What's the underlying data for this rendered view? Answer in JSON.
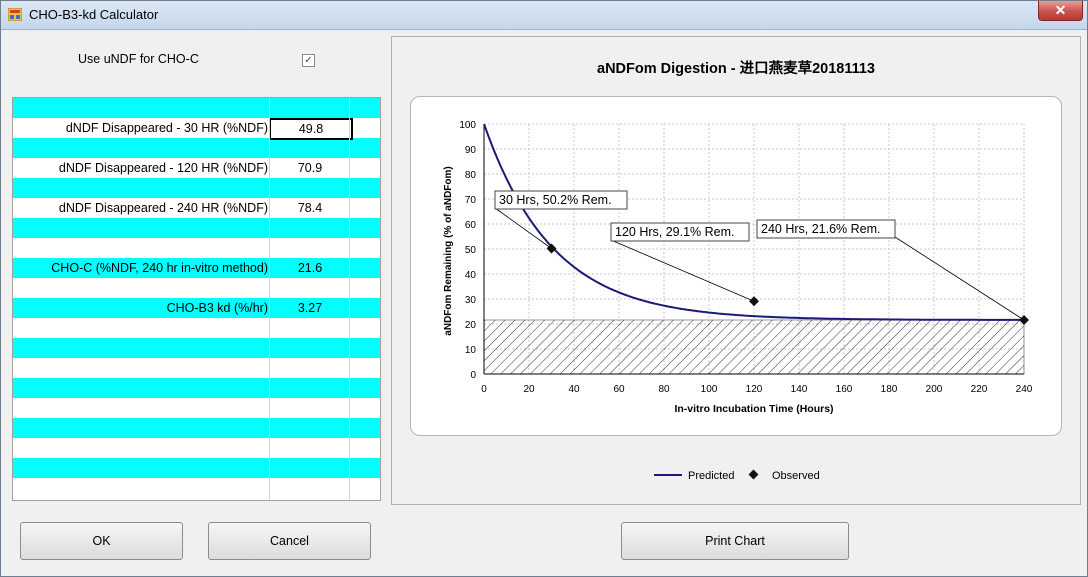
{
  "window": {
    "title": "CHO-B3-kd Calculator",
    "close_glyph": "✕"
  },
  "options": {
    "use_undf_label": "Use uNDF for CHO-C",
    "use_undf_checked": true
  },
  "grid": {
    "rows": [
      {
        "label": "",
        "value": "",
        "color": "cyan"
      },
      {
        "label": "dNDF Disappeared - 30 HR (%NDF)",
        "value": "49.8",
        "color": "white",
        "selected": true
      },
      {
        "label": "",
        "value": "",
        "color": "cyan"
      },
      {
        "label": "dNDF Disappeared - 120 HR (%NDF)",
        "value": "70.9",
        "color": "white"
      },
      {
        "label": "",
        "value": "",
        "color": "cyan"
      },
      {
        "label": "dNDF Disappeared - 240 HR (%NDF)",
        "value": "78.4",
        "color": "white"
      },
      {
        "label": "",
        "value": "",
        "color": "cyan"
      },
      {
        "label": "",
        "value": "",
        "color": "white"
      },
      {
        "label": "CHO-C (%NDF, 240 hr in-vitro method)",
        "value": "21.6",
        "color": "cyan"
      },
      {
        "label": "",
        "value": "",
        "color": "white"
      },
      {
        "label": "CHO-B3 kd (%/hr)",
        "value": "3.27",
        "color": "cyan"
      },
      {
        "label": "",
        "value": "",
        "color": "white"
      },
      {
        "label": "",
        "value": "",
        "color": "cyan"
      },
      {
        "label": "",
        "value": "",
        "color": "white"
      },
      {
        "label": "",
        "value": "",
        "color": "cyan"
      },
      {
        "label": "",
        "value": "",
        "color": "white"
      },
      {
        "label": "",
        "value": "",
        "color": "cyan"
      },
      {
        "label": "",
        "value": "",
        "color": "white"
      },
      {
        "label": "",
        "value": "",
        "color": "cyan"
      },
      {
        "label": "",
        "value": "",
        "color": "white"
      }
    ]
  },
  "buttons": {
    "ok": "OK",
    "cancel": "Cancel",
    "print": "Print Chart"
  },
  "colors": {
    "grid_cyan": "#00ffff",
    "line": "#1a1a7a",
    "marker": "#111111"
  },
  "chart_data": {
    "type": "line",
    "title": "aNDFom Digestion - 进口燕麦草20181113",
    "xlabel": "In-vitro Incubation Time (Hours)",
    "ylabel": "aNDFom Remaining (% of aNDFom)",
    "xlim": [
      0,
      240
    ],
    "ylim": [
      0,
      100
    ],
    "xticks": [
      0,
      20,
      40,
      60,
      80,
      100,
      120,
      140,
      160,
      180,
      200,
      220,
      240
    ],
    "yticks": [
      0,
      10,
      20,
      30,
      40,
      50,
      60,
      70,
      80,
      90,
      100
    ],
    "grid": true,
    "legend_position": "bottom",
    "series": [
      {
        "name": "Predicted",
        "kind": "line",
        "model": "exponential_decay",
        "undigested": 21.6,
        "kd_percent_per_hr": 3.27
      },
      {
        "name": "Observed",
        "kind": "scatter",
        "x": [
          30,
          120,
          240
        ],
        "y": [
          50.2,
          29.1,
          21.6
        ]
      }
    ],
    "annotations": [
      {
        "text": "30 Hrs, 50.2% Rem.",
        "x": 30,
        "y": 50.2
      },
      {
        "text": "120 Hrs, 29.1% Rem.",
        "x": 120,
        "y": 29.1
      },
      {
        "text": "240 Hrs, 21.6% Rem.",
        "x": 240,
        "y": 21.6
      }
    ],
    "hatched_band": {
      "from": 0,
      "to": 21.6
    }
  }
}
